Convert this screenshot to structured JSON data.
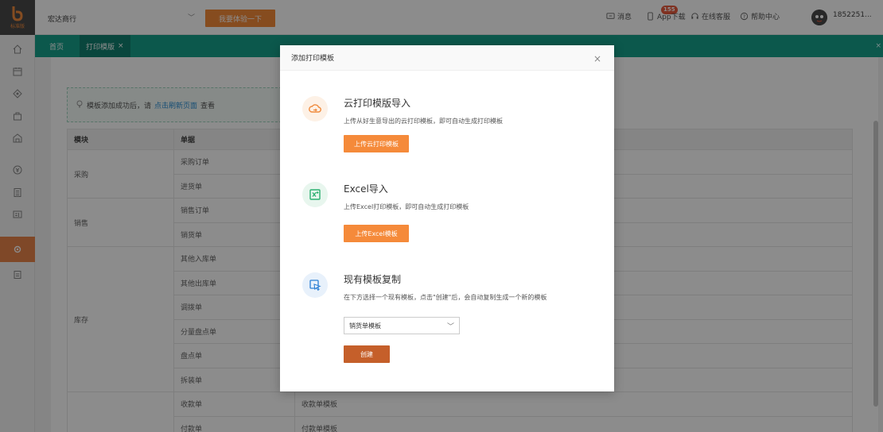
{
  "app": {
    "logo_text": "标准版"
  },
  "topbar": {
    "store_name": "宏达商行",
    "try_button": "我要体验一下",
    "message_label": "消息",
    "message_count": "155",
    "app_download": "App下载",
    "online_service": "在线客服",
    "help_center": "帮助中心",
    "username": "1852251..."
  },
  "tabs": {
    "home": "首页",
    "print_template": "打印模版",
    "close_glyph": "×"
  },
  "notice": {
    "prefix": "模板添加成功后，请",
    "link": "点击刷新页面",
    "suffix": "查看"
  },
  "table": {
    "headers": [
      "模块",
      "单据",
      ""
    ],
    "rows": [
      {
        "module": "采购",
        "docs": [
          "采购订单",
          "进货单"
        ]
      },
      {
        "module": "销售",
        "docs": [
          "销售订单",
          "销货单"
        ]
      },
      {
        "module": "库存",
        "docs": [
          "其他入库单",
          "其他出库单",
          "调拨单",
          "分量盘点单",
          "盘点单",
          "拆装单"
        ]
      },
      {
        "module": "",
        "docs": [
          "收款单",
          "付款单"
        ],
        "templates": [
          "收款单模板",
          "付款单模板"
        ]
      }
    ]
  },
  "modal": {
    "title": "添加打印模板",
    "close": "×",
    "cloud": {
      "title": "云打印模版导入",
      "desc": "上传从好生意导出的云打印模板，即可自动生成打印模板",
      "button": "上传云打印模板"
    },
    "excel": {
      "title": "Excel导入",
      "desc": "上传Excel打印模板，即可自动生成打印模板",
      "button": "上传Excel模板"
    },
    "copy": {
      "title": "现有模板复制",
      "desc": "在下方选择一个现有模板，点击\"创建\"后，会自动复制生成一个新的模板",
      "select_value": "销货单模板",
      "button": "创建"
    }
  },
  "colors": {
    "accent": "#f58a3a",
    "create": "#c55f2a",
    "teal": "#17a08a"
  }
}
